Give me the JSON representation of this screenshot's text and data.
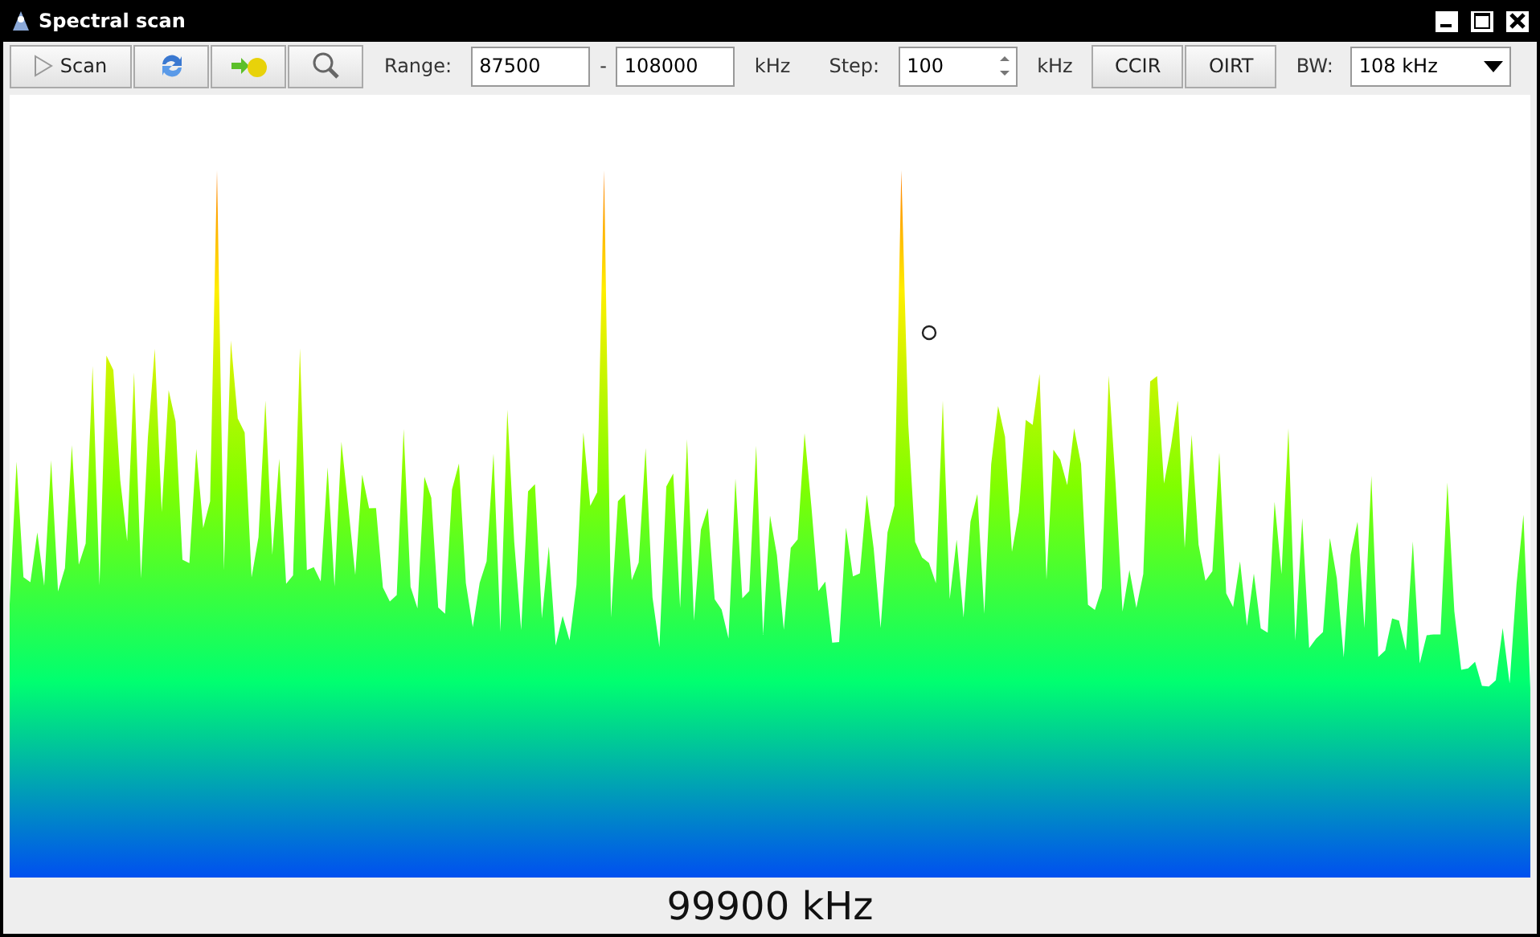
{
  "window": {
    "title": "Spectral scan"
  },
  "toolbar": {
    "scan_button": {
      "label": "Scan"
    },
    "icon_buttons": [
      {
        "kind": "refresh"
      },
      {
        "kind": "arrow-bulb"
      },
      {
        "kind": "zoom"
      }
    ],
    "range": {
      "label": "Range:",
      "from": "87500",
      "separator": "-",
      "to": "108000",
      "unit": "kHz"
    },
    "step": {
      "label": "Step:",
      "value": "100",
      "unit": "kHz"
    },
    "presets": [
      "CCIR",
      "OIRT"
    ],
    "bandwidth": {
      "label": "BW:",
      "value": "108 kHz"
    }
  },
  "readout": "99900 kHz"
}
